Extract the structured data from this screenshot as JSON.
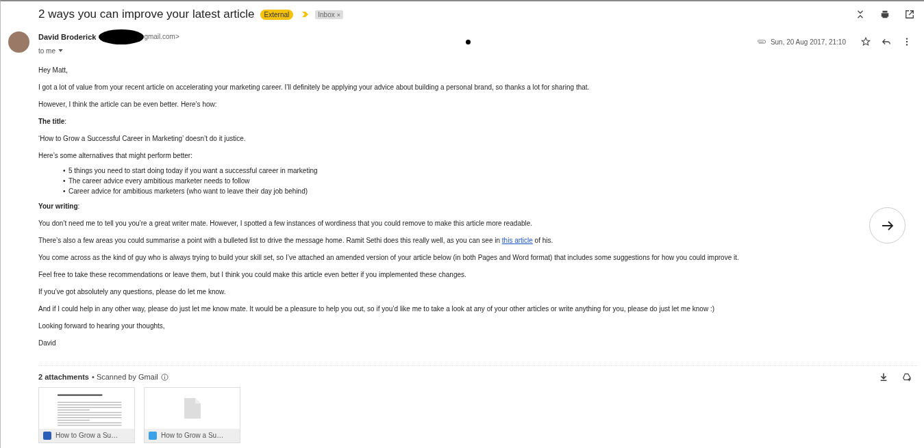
{
  "subject": "2 ways you can improve your latest article",
  "labels": [
    {
      "text": "External",
      "kind": "important"
    },
    {
      "text": "Inbox",
      "kind": "folder",
      "remove_mark": "×"
    }
  ],
  "sender": {
    "name": "David Broderick",
    "email_visible": "gmail.com>",
    "recipient": "to me"
  },
  "date": "Sun, 20 Aug 2017, 21:10",
  "has_attachment": true,
  "body": [
    {
      "kind": "paragraph",
      "text": "Hey Matt,"
    },
    {
      "kind": "paragraph",
      "text": "I got a lot of value from your recent article on accelerating your marketing career. I’ll definitely be applying your advice about building a personal brand, so thanks a lot for sharing that."
    },
    {
      "kind": "paragraph",
      "text": "However, I think the article can be even better. Here’s how:"
    },
    {
      "kind": "paragraph",
      "text": "**The title**:"
    },
    {
      "kind": "paragraph",
      "text": "‘How to Grow a Successful Career in Marketing’ doesn’t do it justice."
    },
    {
      "kind": "paragraph",
      "text": "Here’s some alternatives that might perform better:"
    },
    {
      "kind": "list",
      "bullet": "•",
      "items": [
        "5 things you need to start doing today if you want a successful career in marketing",
        "The career advice every ambitious marketer needs to follow",
        "Career advice for ambitious marketers (who want to leave their day job behind)"
      ]
    },
    {
      "kind": "paragraph",
      "text": "**Your writing**:"
    },
    {
      "kind": "paragraph",
      "text": "You don’t need me to tell you you’re a great writer mate. However, I spotted a few instances of wordiness that you could remove to make this article more readable."
    },
    {
      "kind": "linked",
      "before": "There’s also a few areas you could summarise a point with a bulleted list to drive the message home. Ramit Sethi does this really well, as you can see in",
      "link": "this article",
      "after": "of his."
    },
    {
      "kind": "paragraph",
      "text": "You come across as the kind of guy who is always trying to build your skill set, so I’ve attached an amended version of your article below (in both Pages and Word format) that includes some suggestions for how you could improve it."
    },
    {
      "kind": "paragraph",
      "text": "Feel free to take these recommendations or leave them, but I think you could make this article even better if you implemented these changes."
    },
    {
      "kind": "paragraph",
      "text": "If you’ve got absolutely any questions, please do let me know."
    },
    {
      "kind": "paragraph",
      "text": "And if I could help in any other way, please do just let me know mate. It would be a pleasure to help you out, so if you’d like me to take a look at any of your other articles or write anything for you, please do just let me know :)"
    },
    {
      "kind": "paragraph",
      "text": "Looking forward to hearing your thoughts,"
    },
    {
      "kind": "paragraph",
      "text": "David"
    }
  ],
  "attachments": {
    "count": "2 attachments",
    "scan_note": "• Scanned by Gmail",
    "files": [
      {
        "name": "How to Grow a Su…",
        "kind": "word"
      },
      {
        "name": "How to Grow a Su…",
        "kind": "pages"
      }
    ]
  }
}
